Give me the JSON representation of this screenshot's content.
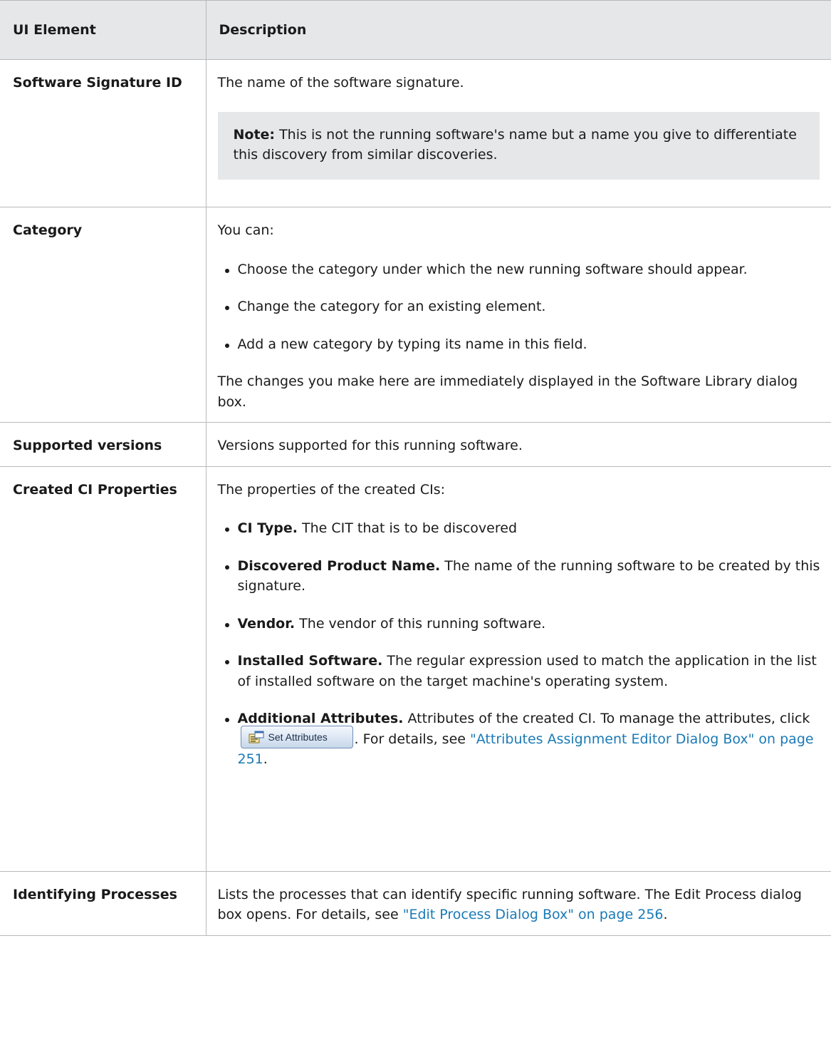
{
  "header": {
    "col1": "UI Element",
    "col2": "Description"
  },
  "rows": {
    "signature": {
      "name": "Software Signature ID",
      "text": "The name of the software signature.",
      "note_label": "Note:",
      "note_text": "This is not the running software's name but a name you give to differentiate this discovery from similar discoveries."
    },
    "category": {
      "name": "Category",
      "intro": "You can:",
      "bullets": [
        "Choose the category under which the new running software should appear.",
        "Change the category for an existing element.",
        "Add a new category by typing its name in this field."
      ],
      "after": "The changes you make here are immediately displayed in the Software Library dialog box."
    },
    "versions": {
      "name": "Supported versions",
      "text": "Versions supported for this running software."
    },
    "ci_props": {
      "name": "Created CI Properties",
      "intro": "The properties of the created CIs:",
      "items": [
        {
          "term": "CI Type.",
          "text": " The CIT that is to be discovered"
        },
        {
          "term": "Discovered Product Name.",
          "text": " The name of the running software to be created by this signature."
        },
        {
          "term": "Vendor.",
          "text": " The vendor of this running software."
        },
        {
          "term": "Installed Software.",
          "text": " The regular expression used to match the application in the list of installed software on the target machine's operating system."
        }
      ],
      "attrs": {
        "term": "Additional Attributes.",
        "text_before": " Attributes of the created CI. To manage the attributes, click ",
        "button_label": "Set Attributes",
        "text_mid": ". For details, see ",
        "link": "\"Attributes Assignment Editor Dialog Box\" on page 251",
        "text_end": "."
      }
    },
    "processes": {
      "name": "Identifying Processes",
      "text_before": "Lists the processes that can identify specific running software. The Edit Process dialog box opens. For details, see ",
      "link": "\"Edit Process Dialog Box\" on page 256",
      "text_end": "."
    }
  },
  "colors": {
    "link": "#1a7ab7",
    "header_bg": "#e6e7e8",
    "note_bg": "#e6e7e8"
  },
  "icons": {
    "set_attributes": "properties-icon"
  }
}
